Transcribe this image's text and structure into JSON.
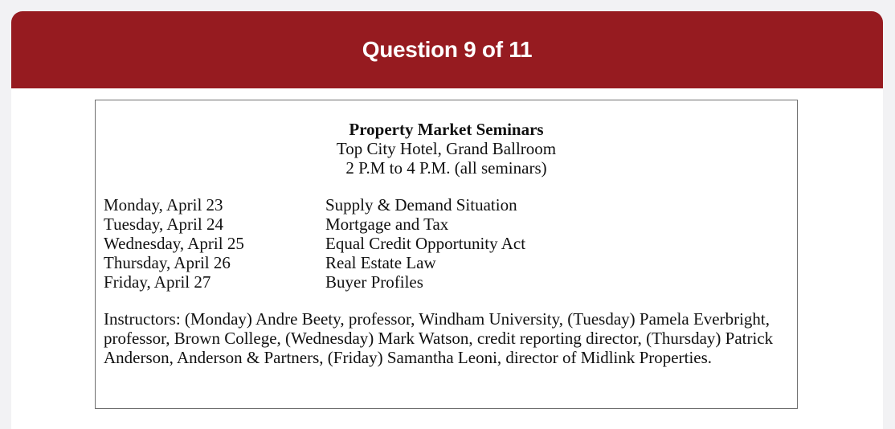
{
  "header": {
    "title": "Question 9 of 11"
  },
  "notice": {
    "title": "Property Market Seminars",
    "location": "Top City Hotel, Grand Ballroom",
    "time": "2 P.M to 4 P.M.  (all seminars)",
    "schedule": [
      {
        "day": "Monday, April 23",
        "topic": "Supply & Demand Situation"
      },
      {
        "day": "Tuesday, April 24",
        "topic": "Mortgage and Tax"
      },
      {
        "day": "Wednesday, April 25",
        "topic": "Equal Credit Opportunity Act"
      },
      {
        "day": "Thursday, April 26",
        "topic": "Real Estate Law"
      },
      {
        "day": "Friday, April 27",
        "topic": "Buyer Profiles"
      }
    ],
    "instructors": "Instructors: (Monday) Andre Beety, professor, Windham University, (Tuesday) Pamela Everbright, professor, Brown College, (Wednesday) Mark Watson, credit reporting director, (Thursday) Patrick Anderson, Anderson & Partners, (Friday) Samantha Leoni, director of Midlink Properties."
  },
  "colors": {
    "header_bg": "#961b20",
    "page_bg": "#f2f2f4"
  }
}
